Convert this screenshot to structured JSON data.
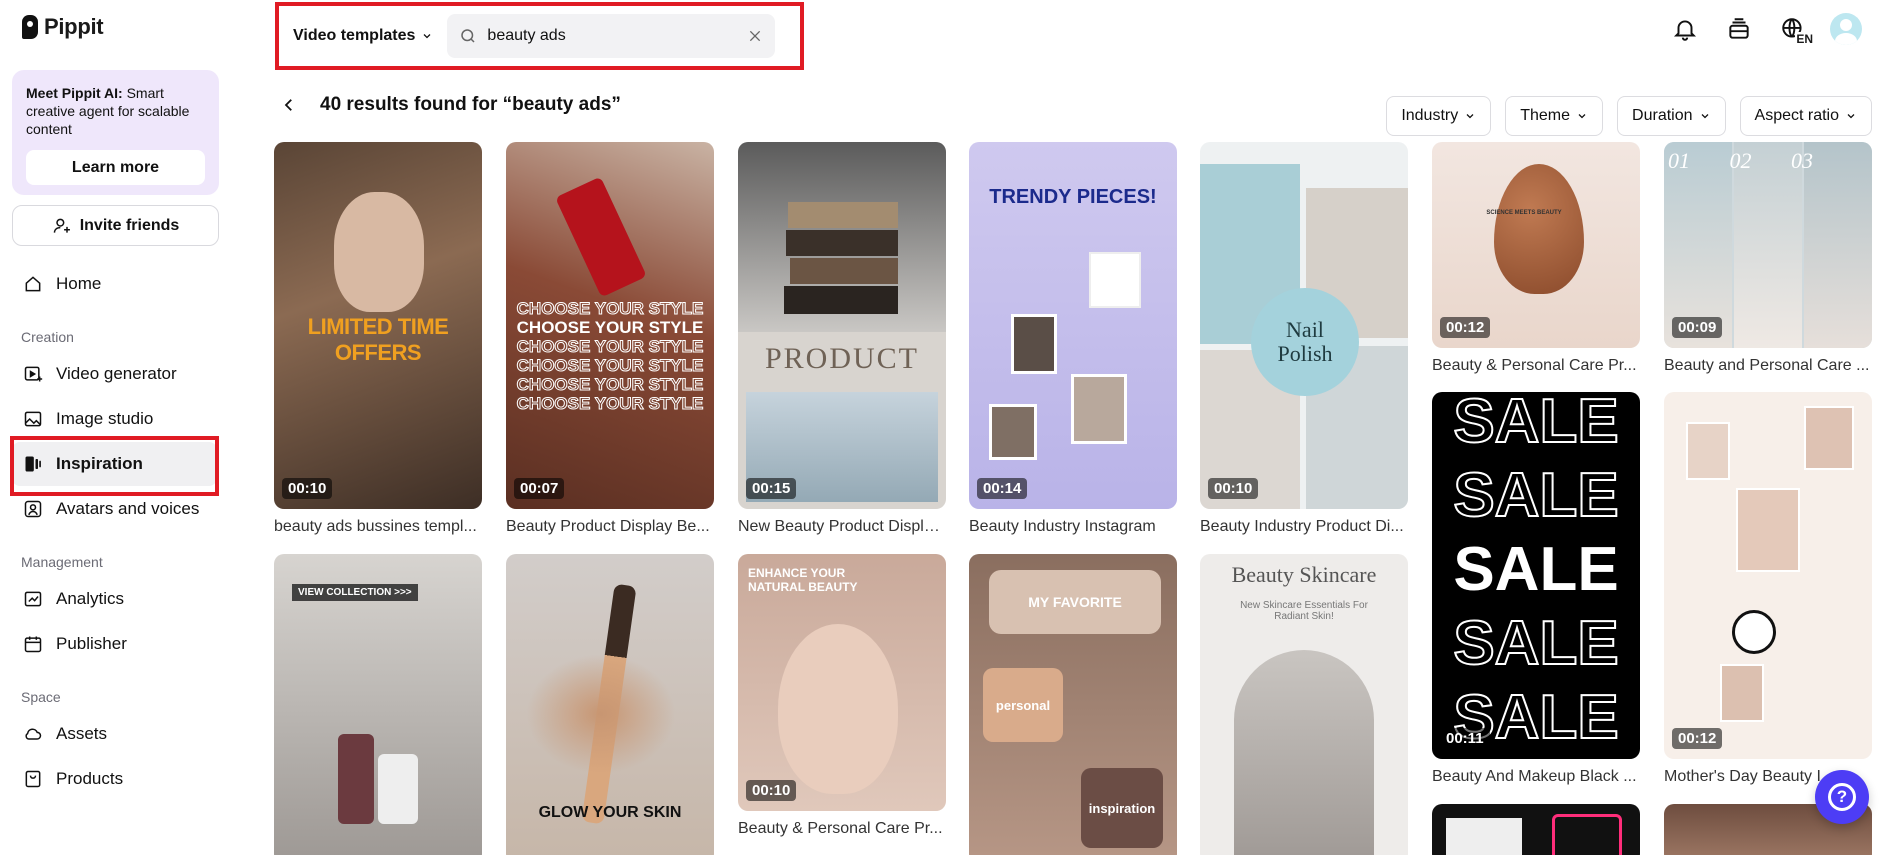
{
  "brand": {
    "name": "Pippit"
  },
  "promo": {
    "title": "Meet Pippit AI:",
    "body": "Smart creative agent for scalable content",
    "button": "Learn more"
  },
  "invite": {
    "label": "Invite friends"
  },
  "nav": {
    "home": "Home",
    "section_creation": "Creation",
    "video_generator": "Video generator",
    "image_studio": "Image studio",
    "inspiration": "Inspiration",
    "avatars": "Avatars and voices",
    "section_management": "Management",
    "analytics": "Analytics",
    "publisher": "Publisher",
    "section_space": "Space",
    "assets": "Assets",
    "products": "Products"
  },
  "search": {
    "type_label": "Video templates",
    "query": "beauty ads",
    "placeholder": "Search"
  },
  "lang": {
    "code": "EN"
  },
  "results": {
    "title": "40 results found for “beauty ads”"
  },
  "filters": [
    "Industry",
    "Theme",
    "Duration",
    "Aspect ratio"
  ],
  "cards": [
    {
      "title": "beauty ads bussines templ...",
      "duration": "00:10",
      "overlay": "LIMITED TIME OFFERS"
    },
    {
      "title": "Beauty Product Display Be...",
      "duration": "00:07",
      "overlay": "CHOOSE YOUR STYLE"
    },
    {
      "title": "New Beauty Product Displa...",
      "duration": "00:15",
      "overlay": "PRODUCT"
    },
    {
      "title": "Beauty Industry Instagram",
      "duration": "00:14",
      "overlay": "TRENDY PIECES!"
    },
    {
      "title": "Beauty Industry Product Di...",
      "duration": "00:10",
      "overlay": "Nail Polish"
    },
    {
      "title": "Beauty & Personal Care Pr...",
      "duration": "00:12",
      "overlay": "SCIENCE MEETS BEAUTY"
    },
    {
      "title": "Beauty and Personal Care ...",
      "duration": "00:09",
      "overlay": "01 02 03"
    },
    {
      "title": "",
      "duration": "",
      "overlay": "VIEW COLLECTION >>>"
    },
    {
      "title": "",
      "duration": "",
      "overlay": "GLOW YOUR SKIN"
    },
    {
      "title": "Beauty & Personal Care Pr...",
      "duration": "00:10",
      "overlay": "ENHANCE YOUR NATURAL BEAUTY"
    },
    {
      "title": "",
      "duration": "",
      "overlay": "MY FAVORITE",
      "extra1": "personal",
      "extra2": "inspiration"
    },
    {
      "title": "",
      "duration": "",
      "overlay": "Beauty Skincare",
      "sub": "New Skincare Essentials For Radiant Skin!"
    },
    {
      "title": "Beauty And Makeup Black ...",
      "duration": "00:11",
      "overlay": "SALE"
    },
    {
      "title": "Mother's Day Beauty I...",
      "duration": "00:12",
      "overlay": ""
    }
  ],
  "colors": {
    "accent": "#4d3df5",
    "highlight": "#e01b24",
    "promo_bg": "#efe7fb"
  }
}
